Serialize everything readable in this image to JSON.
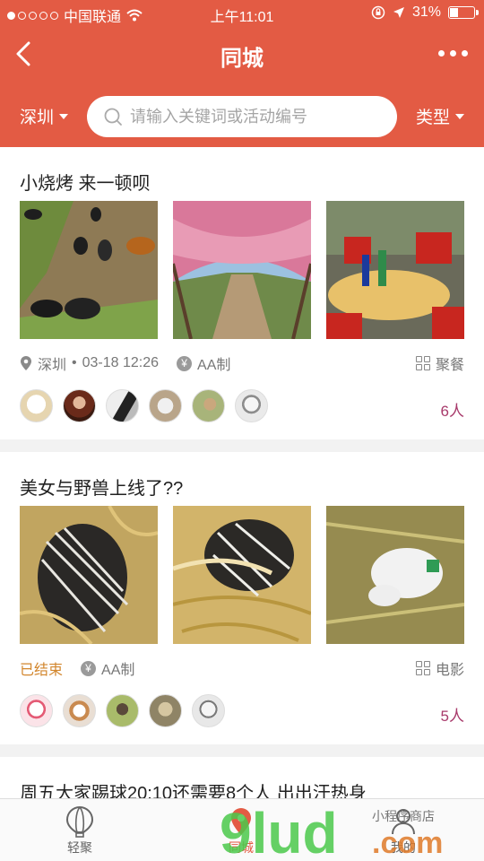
{
  "status_bar": {
    "carrier": "中国联通",
    "time": "上午11:01",
    "battery": "31%",
    "battery_level": 0.31
  },
  "nav": {
    "title": "同城",
    "back_icon": "chevron-left-icon",
    "more_icon": "more-dots-icon"
  },
  "filters": {
    "city": "深圳",
    "search_placeholder": "请输入关键词或活动编号",
    "type": "类型"
  },
  "events": [
    {
      "title": "小烧烤 来一顿呗",
      "photos": [
        "chickens-photo",
        "pink-blossom-path-photo",
        "outdoor-table-photo"
      ],
      "location": "深圳",
      "datetime": "03-18 12:26",
      "payment": "AA制",
      "category": "聚餐",
      "participants": "6人",
      "avatar_count": 6
    },
    {
      "title": "美女与野兽上线了??",
      "photos": [
        "porcupine-photo-1",
        "porcupine-photo-2",
        "hay-animal-photo"
      ],
      "status": "已结束",
      "payment": "AA制",
      "category": "电影",
      "participants": "5人",
      "avatar_count": 5
    },
    {
      "title": "周五大家踢球20:10还需要8个人 出出汗热身"
    }
  ],
  "tabs": [
    {
      "label": "轻聚",
      "icon": "balloon-icon",
      "active": false
    },
    {
      "label": "同城",
      "icon": "location-pin-icon",
      "active": true
    },
    {
      "label": "我的",
      "icon": "person-icon",
      "active": false
    }
  ],
  "watermark": {
    "text": "9lud.com",
    "subtext": "小程序商店"
  },
  "colors": {
    "brand": "#e35b44",
    "ended": "#d2862d",
    "count": "#a83a6b"
  }
}
